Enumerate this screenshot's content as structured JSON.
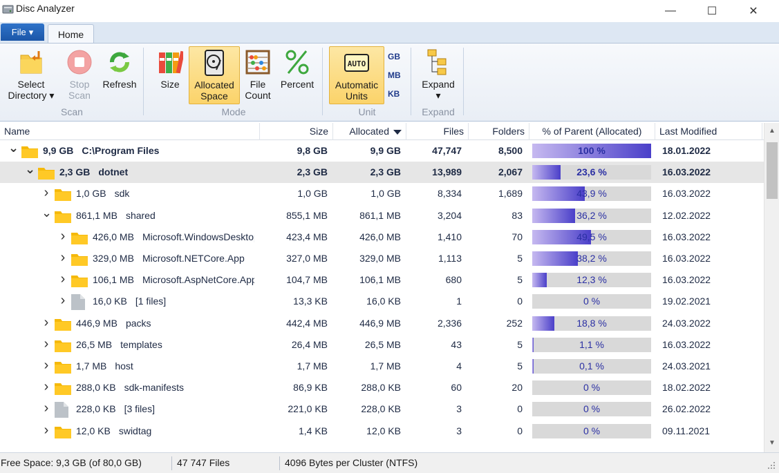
{
  "window": {
    "title": "Disc Analyzer",
    "minimize_glyph": "—",
    "maximize_glyph": "☐",
    "close_glyph": "✕"
  },
  "ribbon": {
    "file_tab": "File",
    "home_tab": "Home",
    "buttons": {
      "select_directory": {
        "line1": "Select",
        "line2": "Directory ▾"
      },
      "stop_scan": {
        "line1": "Stop",
        "line2": "Scan"
      },
      "refresh": {
        "line1": "Refresh",
        "line2": ""
      },
      "size": {
        "line1": "Size",
        "line2": ""
      },
      "allocated_space": {
        "line1": "Allocated",
        "line2": "Space"
      },
      "file_count": {
        "line1": "File",
        "line2": "Count"
      },
      "percent": {
        "line1": "Percent",
        "line2": ""
      },
      "automatic_units": {
        "line1": "Automatic",
        "line2": "Units"
      },
      "expand": {
        "line1": "Expand",
        "line2": "▾"
      }
    },
    "unit_options": [
      "GB",
      "MB",
      "KB"
    ],
    "groups": {
      "scan": "Scan",
      "mode": "Mode",
      "unit": "Unit",
      "expand": "Expand"
    }
  },
  "columns": {
    "name": "Name",
    "size": "Size",
    "allocated": "Allocated",
    "files": "Files",
    "folders": "Folders",
    "percent": "% of Parent (Allocated)",
    "modified": "Last Modified"
  },
  "rows": [
    {
      "level": 0,
      "expanded": true,
      "type": "folder",
      "style": "root",
      "size_label": "9,9 GB",
      "name": "C:\\Program Files",
      "size": "9,8 GB",
      "allocated": "9,9 GB",
      "files": "47,747",
      "folders": "8,500",
      "pct": 100,
      "pct_label": "100 %",
      "modified": "18.01.2022"
    },
    {
      "level": 1,
      "expanded": true,
      "type": "folder",
      "style": "selected",
      "size_label": "2,3 GB",
      "name": "dotnet",
      "size": "2,3 GB",
      "allocated": "2,3 GB",
      "files": "13,989",
      "folders": "2,067",
      "pct": 23.6,
      "pct_label": "23,6 %",
      "modified": "16.03.2022"
    },
    {
      "level": 2,
      "expanded": false,
      "type": "folder",
      "style": "",
      "size_label": "1,0 GB",
      "name": "sdk",
      "size": "1,0 GB",
      "allocated": "1,0 GB",
      "files": "8,334",
      "folders": "1,689",
      "pct": 43.9,
      "pct_label": "43,9 %",
      "modified": "16.03.2022"
    },
    {
      "level": 2,
      "expanded": true,
      "type": "folder",
      "style": "",
      "size_label": "861,1 MB",
      "name": "shared",
      "size": "855,1 MB",
      "allocated": "861,1 MB",
      "files": "3,204",
      "folders": "83",
      "pct": 36.2,
      "pct_label": "36,2 %",
      "modified": "12.02.2022"
    },
    {
      "level": 3,
      "expanded": false,
      "type": "folder",
      "style": "",
      "size_label": "426,0 MB",
      "name": "Microsoft.WindowsDesktop.App",
      "size": "423,4 MB",
      "allocated": "426,0 MB",
      "files": "1,410",
      "folders": "70",
      "pct": 49.5,
      "pct_label": "49,5 %",
      "modified": "16.03.2022"
    },
    {
      "level": 3,
      "expanded": false,
      "type": "folder",
      "style": "",
      "size_label": "329,0 MB",
      "name": "Microsoft.NETCore.App",
      "size": "327,0 MB",
      "allocated": "329,0 MB",
      "files": "1,113",
      "folders": "5",
      "pct": 38.2,
      "pct_label": "38,2 %",
      "modified": "16.03.2022"
    },
    {
      "level": 3,
      "expanded": false,
      "type": "folder",
      "style": "",
      "size_label": "106,1 MB",
      "name": "Microsoft.AspNetCore.App",
      "size": "104,7 MB",
      "allocated": "106,1 MB",
      "files": "680",
      "folders": "5",
      "pct": 12.3,
      "pct_label": "12,3 %",
      "modified": "16.03.2022"
    },
    {
      "level": 3,
      "expanded": false,
      "type": "file",
      "style": "",
      "size_label": "16,0 KB",
      "name": "[1 files]",
      "size": "13,3 KB",
      "allocated": "16,0 KB",
      "files": "1",
      "folders": "0",
      "pct": 0,
      "pct_label": "0 %",
      "modified": "19.02.2021"
    },
    {
      "level": 2,
      "expanded": false,
      "type": "folder",
      "style": "",
      "size_label": "446,9 MB",
      "name": "packs",
      "size": "442,4 MB",
      "allocated": "446,9 MB",
      "files": "2,336",
      "folders": "252",
      "pct": 18.8,
      "pct_label": "18,8 %",
      "modified": "24.03.2022"
    },
    {
      "level": 2,
      "expanded": false,
      "type": "folder",
      "style": "",
      "size_label": "26,5 MB",
      "name": "templates",
      "size": "26,4 MB",
      "allocated": "26,5 MB",
      "files": "43",
      "folders": "5",
      "pct": 1.1,
      "pct_label": "1,1 %",
      "modified": "16.03.2022"
    },
    {
      "level": 2,
      "expanded": false,
      "type": "folder",
      "style": "",
      "size_label": "1,7 MB",
      "name": "host",
      "size": "1,7 MB",
      "allocated": "1,7 MB",
      "files": "4",
      "folders": "5",
      "pct": 0.1,
      "pct_label": "0,1 %",
      "modified": "24.03.2021"
    },
    {
      "level": 2,
      "expanded": false,
      "type": "folder",
      "style": "",
      "size_label": "288,0 KB",
      "name": "sdk-manifests",
      "size": "86,9 KB",
      "allocated": "288,0 KB",
      "files": "60",
      "folders": "20",
      "pct": 0,
      "pct_label": "0 %",
      "modified": "18.02.2022"
    },
    {
      "level": 2,
      "expanded": false,
      "type": "file",
      "style": "",
      "size_label": "228,0 KB",
      "name": "[3 files]",
      "size": "221,0 KB",
      "allocated": "228,0 KB",
      "files": "3",
      "folders": "0",
      "pct": 0,
      "pct_label": "0 %",
      "modified": "26.02.2022"
    },
    {
      "level": 2,
      "expanded": false,
      "type": "folder",
      "style": "",
      "size_label": "12,0 KB",
      "name": "swidtag",
      "size": "1,4 KB",
      "allocated": "12,0 KB",
      "files": "3",
      "folders": "0",
      "pct": 0,
      "pct_label": "0 %",
      "modified": "09.11.2021"
    }
  ],
  "statusbar": {
    "free_space": "Free Space: 9,3 GB (of 80,0 GB)",
    "files": "47 747 Files",
    "cluster": "4096 Bytes per Cluster (NTFS)"
  }
}
